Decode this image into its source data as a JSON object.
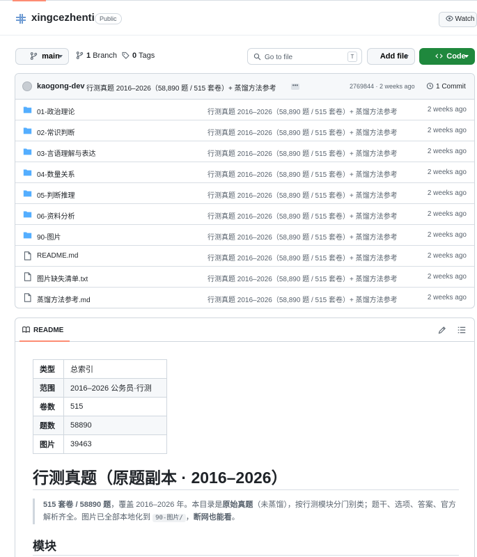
{
  "repo": {
    "name": "xingcezhenti",
    "visibility": "Public",
    "watch_label": "Watch"
  },
  "toolbar": {
    "branch": "main",
    "branch_count": "1",
    "branch_label": "Branch",
    "tag_count": "0",
    "tag_label": "Tags",
    "goto_placeholder": "Go to file",
    "goto_kbd": "T",
    "add_file_label": "Add file",
    "code_label": "Code"
  },
  "commit": {
    "author": "kaogong-dev",
    "message": "行测真题 2016–2026（58,890 题 / 515 套卷）+ 蒸馏方法参考",
    "ellipsis": "•••",
    "hash_time": "2769844 · 2 weeks ago",
    "count_label": "1 Commit"
  },
  "files": [
    {
      "name": "01-政治理论",
      "type": "folder",
      "message": "行测真题 2016–2026（58,890 题 / 515 套卷）+ 蒸馏方法参考",
      "time": "2 weeks ago"
    },
    {
      "name": "02-常识判断",
      "type": "folder",
      "message": "行测真题 2016–2026（58,890 题 / 515 套卷）+ 蒸馏方法参考",
      "time": "2 weeks ago"
    },
    {
      "name": "03-言语理解与表达",
      "type": "folder",
      "message": "行测真题 2016–2026（58,890 题 / 515 套卷）+ 蒸馏方法参考",
      "time": "2 weeks ago"
    },
    {
      "name": "04-数量关系",
      "type": "folder",
      "message": "行测真题 2016–2026（58,890 题 / 515 套卷）+ 蒸馏方法参考",
      "time": "2 weeks ago"
    },
    {
      "name": "05-判断推理",
      "type": "folder",
      "message": "行测真题 2016–2026（58,890 题 / 515 套卷）+ 蒸馏方法参考",
      "time": "2 weeks ago"
    },
    {
      "name": "06-资料分析",
      "type": "folder",
      "message": "行测真题 2016–2026（58,890 题 / 515 套卷）+ 蒸馏方法参考",
      "time": "2 weeks ago"
    },
    {
      "name": "90-图片",
      "type": "folder",
      "message": "行测真题 2016–2026（58,890 题 / 515 套卷）+ 蒸馏方法参考",
      "time": "2 weeks ago"
    },
    {
      "name": "README.md",
      "type": "file",
      "message": "行测真题 2016–2026（58,890 题 / 515 套卷）+ 蒸馏方法参考",
      "time": "2 weeks ago"
    },
    {
      "name": "图片缺失清单.txt",
      "type": "file",
      "message": "行测真题 2016–2026（58,890 题 / 515 套卷）+ 蒸馏方法参考",
      "time": "2 weeks ago"
    },
    {
      "name": "蒸馏方法参考.md",
      "type": "file",
      "message": "行测真题 2016–2026（58,890 题 / 515 套卷）+ 蒸馏方法参考",
      "time": "2 weeks ago"
    }
  ],
  "readme": {
    "tab_label": "README",
    "table": [
      {
        "key": "类型",
        "value": "总索引"
      },
      {
        "key": "范围",
        "value": "2016–2026 公务员·行测"
      },
      {
        "key": "卷数",
        "value": "515"
      },
      {
        "key": "题数",
        "value": "58890"
      },
      {
        "key": "图片",
        "value": "39463"
      }
    ],
    "title": "行测真题（原题副本 · 2016–2026）",
    "quote": {
      "p1_bold": "515 套卷 / 58890 题",
      "p2": "，覆盖 2016–2026 年。本目录是",
      "p3_bold": "原始真题",
      "p4": "（未蒸馏），按行测模块分门别类；题干、选项、答案、官方解析齐全。图片已全部本地化到 ",
      "p5_code": "90-图片/",
      "p6": "，",
      "p7_bold": "断网也能看",
      "p8": "。"
    },
    "section_heading": "模块"
  },
  "colors": {
    "accent_green": "#1f883d",
    "tab_underline": "#fd8c73",
    "folder_blue": "#54aeff",
    "border": "#d0d7de",
    "muted_text": "#59636e"
  }
}
